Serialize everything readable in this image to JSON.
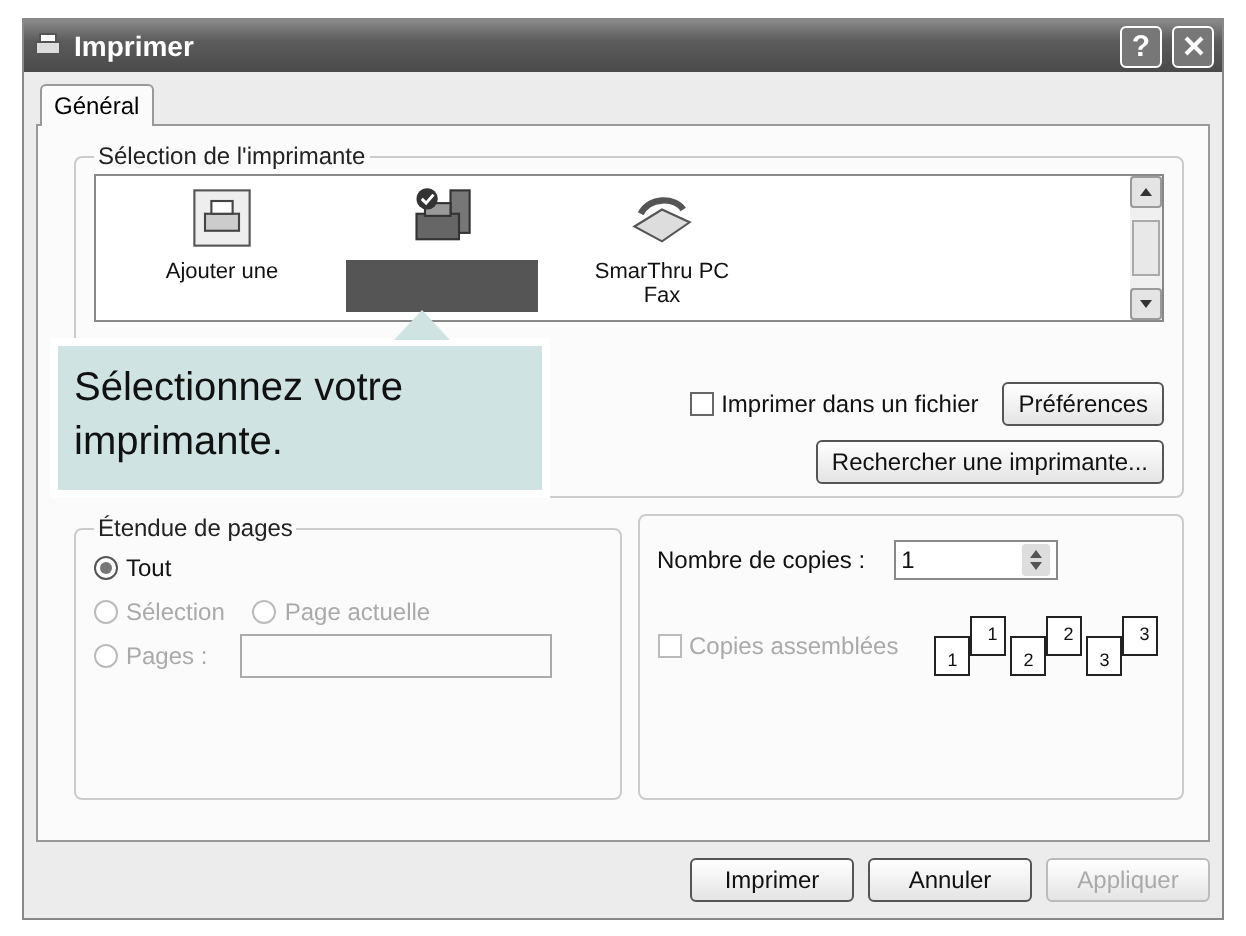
{
  "window": {
    "title": "Imprimer",
    "help_label": "?"
  },
  "tabs": [
    {
      "label": "Général",
      "selected": true
    }
  ],
  "printer_selection": {
    "title": "Sélection de l'imprimante",
    "printers": [
      {
        "kind": "add",
        "label": "Ajouter une",
        "selected": false
      },
      {
        "kind": "printer",
        "selected": true
      },
      {
        "kind": "fax",
        "label": "SmarThru PC Fax",
        "selected": false
      }
    ],
    "print_to_file": {
      "label": "Imprimer dans un fichier",
      "checked": false
    },
    "preferences_button": "Préférences",
    "find_button": "Rechercher une imprimante..."
  },
  "callout": {
    "text": "Sélectionnez votre imprimante."
  },
  "page_range": {
    "title": "Étendue de pages",
    "options": [
      {
        "label": "Tout",
        "selected": true,
        "disabled": false
      },
      {
        "label": "Sélection",
        "selected": false,
        "disabled": true
      },
      {
        "label": "Page actuelle",
        "selected": false,
        "disabled": true
      },
      {
        "label": "Pages :",
        "selected": false,
        "disabled": true
      }
    ]
  },
  "copies": {
    "label": "Nombre de copies :",
    "value": "1",
    "collate": {
      "label": "Copies assemblées",
      "checked": false,
      "disabled": true
    },
    "collate_sets": [
      {
        "back": "1",
        "front": "1"
      },
      {
        "back": "2",
        "front": "2"
      },
      {
        "back": "3",
        "front": "3"
      }
    ]
  },
  "buttons": [
    {
      "label": "Imprimer",
      "disabled": false
    },
    {
      "label": "Annuler",
      "disabled": false
    },
    {
      "label": "Appliquer",
      "disabled": true
    }
  ]
}
